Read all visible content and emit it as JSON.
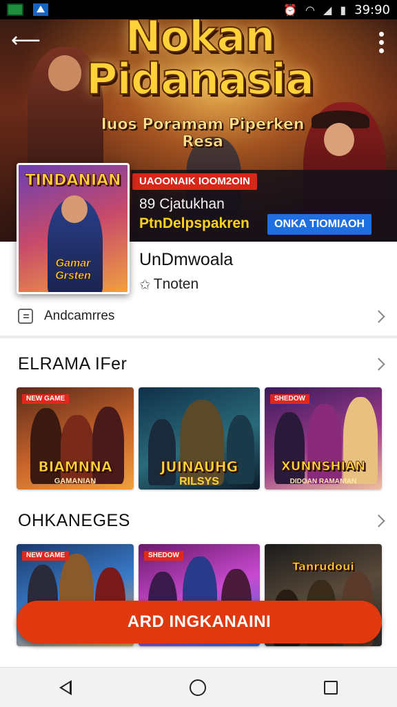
{
  "status_bar": {
    "time": "39:90",
    "icons": [
      "alarm-icon",
      "wifi-icon",
      "signal-icon",
      "battery-icon"
    ]
  },
  "hero": {
    "title_line1": "Nokan",
    "title_line2": "Pidanasia",
    "subtitle": "Iuos Poramam Piperken Resa",
    "promo_tag": "UAOONAIK IOOM2OIN",
    "meta": "89  Cjatukhan",
    "developer": "PtnDelpspakren",
    "online_badge": "ONKA TIOMIAOH",
    "cover_title": "TINDANIAN",
    "cover_subtitle_line1": "Gamar",
    "cover_subtitle_line2": "Grsten"
  },
  "app": {
    "name": "UnDmwoala",
    "rating": "Tnoten",
    "install_label": "Andcamrres"
  },
  "sections": [
    {
      "title": "ELRAMA IFer",
      "cards": [
        {
          "tag": "NEW GAME",
          "title": "BIAMNNA",
          "subtitle": "GAMANIAN"
        },
        {
          "tag": "",
          "title": "JUINAUHG",
          "subtitle": "RILSYS"
        },
        {
          "tag": "SHEDOW",
          "title": "XUNNSHIAN",
          "subtitle": "DIDOAN RAMANIAN"
        }
      ]
    },
    {
      "title": "OHKANEGES",
      "cards": [
        {
          "tag": "NEW GAME",
          "title": "",
          "subtitle": ""
        },
        {
          "tag": "SHEDOW",
          "title": "",
          "subtitle": ""
        },
        {
          "tag": "",
          "title": "Tanrudoui",
          "subtitle": ""
        }
      ]
    }
  ],
  "cta": {
    "label": "ARD INGKANAINI"
  },
  "colors": {
    "accent": "#e0380f",
    "promo_red": "#d62718",
    "badge_blue": "#1f6fe0",
    "developer_yellow": "#ffd21f"
  }
}
